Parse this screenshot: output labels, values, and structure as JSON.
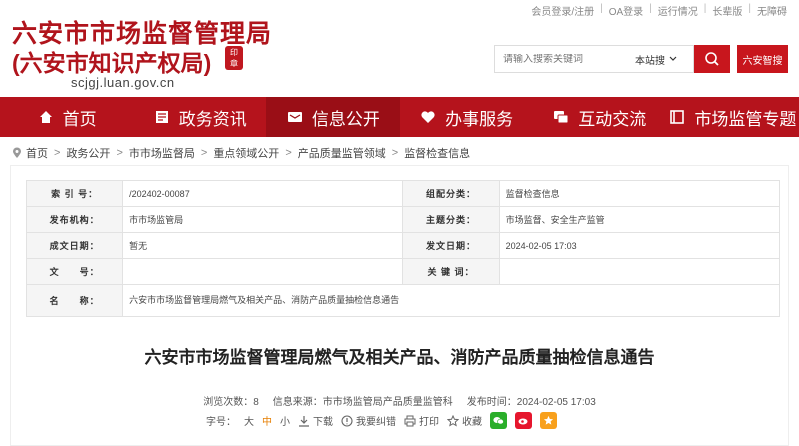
{
  "top_links": [
    "会员登录/注册",
    "OA登录",
    "运行情况",
    "长辈版",
    "无障碍"
  ],
  "site": {
    "title_line1": "六安市市场监督管理局",
    "title_line2": "(六安市知识产权局)",
    "domain": "scjgj.luan.gov.cn",
    "seal_text": "印章"
  },
  "search": {
    "placeholder": "请输入搜索关键词",
    "scope": "本站搜",
    "wechat_label": "六安智搜"
  },
  "nav": [
    {
      "label": "首页",
      "icon": "home-icon"
    },
    {
      "label": "政务资讯",
      "icon": "news-icon"
    },
    {
      "label": "信息公开",
      "icon": "open-info-icon"
    },
    {
      "label": "办事服务",
      "icon": "heart-icon"
    },
    {
      "label": "互动交流",
      "icon": "chat-icon"
    },
    {
      "label": "市场监管专题",
      "icon": "book-icon"
    }
  ],
  "breadcrumb": [
    "首页",
    "政务公开",
    "市市场监督局",
    "重点领域公开",
    "产品质量监管领域",
    "监督检查信息"
  ],
  "info": {
    "index_label": "索 引 号：",
    "index_value": "/202402-00087",
    "category_label": "组配分类：",
    "category_value": "监督检查信息",
    "publisher_label": "发布机构：",
    "publisher_value": "市市场监管局",
    "topic_label": "主题分类：",
    "topic_value": "市场监督、安全生产监管",
    "created_label": "成文日期：",
    "created_value": "暂无",
    "published_label": "发文日期：",
    "published_value": "2024-02-05 17:03",
    "docno_label": "文　　号：",
    "docno_value": "",
    "keywords_label": "关 键 词：",
    "keywords_value": "",
    "name_label": "名　　称：",
    "name_value": "六安市市场监督管理局燃气及相关产品、消防产品质量抽检信息通告"
  },
  "article": {
    "title": "六安市市场监督管理局燃气及相关产品、消防产品质量抽检信息通告",
    "views": "浏览次数：8",
    "source": "信息来源：市市场监管局产品质量监管科",
    "time": "发布时间：2024-02-05 17:03"
  },
  "tools": {
    "font_label": "字号：",
    "sizes": [
      "大",
      "中",
      "小"
    ],
    "download": "下载",
    "correct": "我要纠错",
    "print": "打印",
    "favorite": "收藏"
  }
}
